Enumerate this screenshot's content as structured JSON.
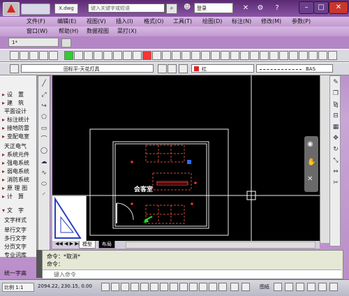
{
  "title_bar": {
    "file_name": "X.dwg",
    "search_placeholder": "键入关键字或短语",
    "login_label": "登录"
  },
  "menus": {
    "row1": [
      "文件(F)",
      "编辑(E)",
      "视图(V)",
      "插入(I)",
      "格式(O)",
      "工具(T)",
      "绘图(D)",
      "标注(N)",
      "修改(M)",
      "参数(P)"
    ],
    "row2": [
      "窗口(W)",
      "帮助(H)",
      "数据视图",
      "菜打(X)"
    ]
  },
  "doc_tab": {
    "label": "1*"
  },
  "layer": {
    "name": "田标平-天花灯具"
  },
  "properties": {
    "color": {
      "label": "红",
      "value": "#e02020"
    },
    "linetype": "BAS"
  },
  "left_panel": {
    "items": [
      {
        "arrow": "▸",
        "label": "设　置"
      },
      {
        "arrow": "▸",
        "label": "建　筑"
      },
      {
        "arrow": "",
        "label": "平面设计"
      },
      {
        "arrow": "▸",
        "label": "标注统计"
      },
      {
        "arrow": "▸",
        "label": "接地防雷"
      },
      {
        "arrow": "▸",
        "label": "变配电室"
      },
      {
        "arrow": "",
        "label": "天正电气"
      },
      {
        "arrow": "▸",
        "label": "系统元件"
      },
      {
        "arrow": "▸",
        "label": "强电系统"
      },
      {
        "arrow": "▸",
        "label": "弱电系统"
      },
      {
        "arrow": "▸",
        "label": "消防系统"
      },
      {
        "arrow": "▸",
        "label": "原 理 图"
      },
      {
        "arrow": "▸",
        "label": "计　算"
      },
      {
        "arrow": "▾",
        "label": "文　字"
      },
      {
        "arrow": "",
        "label": "文字样式"
      },
      {
        "arrow": "",
        "label": "单行文字"
      },
      {
        "arrow": "",
        "label": "多行文字"
      },
      {
        "arrow": "",
        "label": "分页文字"
      },
      {
        "arrow": "",
        "label": "专业词库"
      },
      {
        "arrow": "",
        "label": "统一字高"
      }
    ]
  },
  "drawing": {
    "room_label": "会客室"
  },
  "layout_tabs": [
    "模型",
    "布局"
  ],
  "command": {
    "line1": "命令：*取消*",
    "line2": "命令：",
    "input_placeholder": "键入命令"
  },
  "status": {
    "scale": "比例 1:1",
    "coords": "2094.22, 230.15, 0.00",
    "grid_label": "图纸"
  }
}
